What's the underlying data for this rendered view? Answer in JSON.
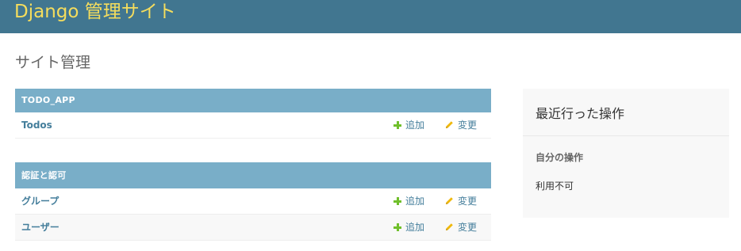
{
  "header": {
    "site_name": "Django 管理サイト",
    "background_color": "#417690",
    "branding_color": "#f5dd5d"
  },
  "page": {
    "title": "サイト管理"
  },
  "apps": [
    {
      "caption": "TODO_APP",
      "models": [
        {
          "name": "Todos",
          "add_label": "追加",
          "change_label": "変更"
        }
      ]
    },
    {
      "caption": "認証と認可",
      "models": [
        {
          "name": "グループ",
          "add_label": "追加",
          "change_label": "変更"
        },
        {
          "name": "ユーザー",
          "add_label": "追加",
          "change_label": "変更"
        }
      ]
    }
  ],
  "recent_actions": {
    "title": "最近行った操作",
    "my_actions_heading": "自分の操作",
    "empty_text": "利用不可"
  },
  "icons": {
    "add": "plus-icon",
    "change": "pencil-icon"
  },
  "colors": {
    "module_caption": "#79aec8",
    "link": "#447e9b",
    "add_icon": "#70bf2b",
    "change_icon": "#efb80b"
  }
}
